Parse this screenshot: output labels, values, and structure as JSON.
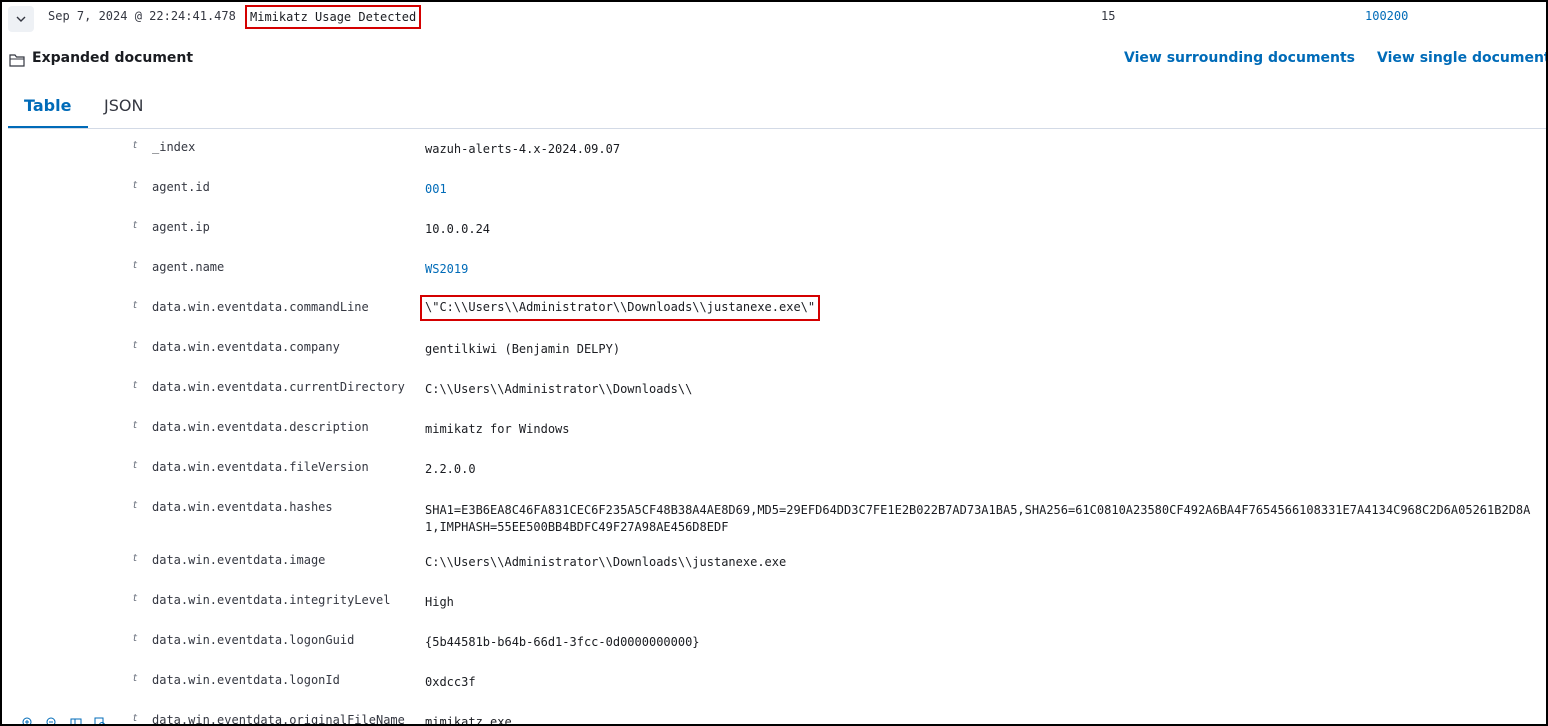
{
  "summary": {
    "timestamp": "Sep 7, 2024 @ 22:24:41.478",
    "rule_description": "Mimikatz Usage Detected",
    "rule_level": "15",
    "rule_id": "100200"
  },
  "header": {
    "title": "Expanded document",
    "view_surrounding": "View surrounding documents",
    "view_single": "View single document"
  },
  "tabs": [
    {
      "label": "Table",
      "active": true
    },
    {
      "label": "JSON",
      "active": false
    }
  ],
  "type_glyph": "t",
  "fields": [
    {
      "key": "_index",
      "value": "wazuh-alerts-4.x-2024.09.07"
    },
    {
      "key": "agent.id",
      "value": "001"
    },
    {
      "key": "agent.ip",
      "value": "10.0.0.24"
    },
    {
      "key": "agent.name",
      "value": "WS2019"
    },
    {
      "key": "data.win.eventdata.commandLine",
      "value": "\\\"C:\\\\Users\\\\Administrator\\\\Downloads\\\\justanexe.exe\\\""
    },
    {
      "key": "data.win.eventdata.company",
      "value": "gentilkiwi (Benjamin DELPY)"
    },
    {
      "key": "data.win.eventdata.currentDirectory",
      "value": "C:\\\\Users\\\\Administrator\\\\Downloads\\\\"
    },
    {
      "key": "data.win.eventdata.description",
      "value": "mimikatz for Windows"
    },
    {
      "key": "data.win.eventdata.fileVersion",
      "value": "2.2.0.0"
    },
    {
      "key": "data.win.eventdata.hashes",
      "value": "SHA1=E3B6EA8C46FA831CEC6F235A5CF48B38A4AE8D69,MD5=29EFD64DD3C7FE1E2B022B7AD73A1BA5,SHA256=61C0810A23580CF492A6BA4F7654566108331E7A4134C968C2D6A05261B2D8A1,IMPHASH=55EE500BB4BDFC49F27A98AE456D8EDF"
    },
    {
      "key": "data.win.eventdata.image",
      "value": "C:\\\\Users\\\\Administrator\\\\Downloads\\\\justanexe.exe"
    },
    {
      "key": "data.win.eventdata.integrityLevel",
      "value": "High"
    },
    {
      "key": "data.win.eventdata.logonGuid",
      "value": "{5b44581b-b64b-66d1-3fcc-0d0000000000}"
    },
    {
      "key": "data.win.eventdata.logonId",
      "value": "0xdcc3f"
    },
    {
      "key": "data.win.eventdata.originalFileName",
      "value": "mimikatz.exe"
    }
  ],
  "colors": {
    "accent": "#006bb8",
    "highlight": "#d40000"
  },
  "icons": [
    "chevron-down-icon",
    "folder-icon",
    "zoom-in-icon",
    "zoom-out-icon",
    "columns-icon",
    "inspect-icon"
  ]
}
